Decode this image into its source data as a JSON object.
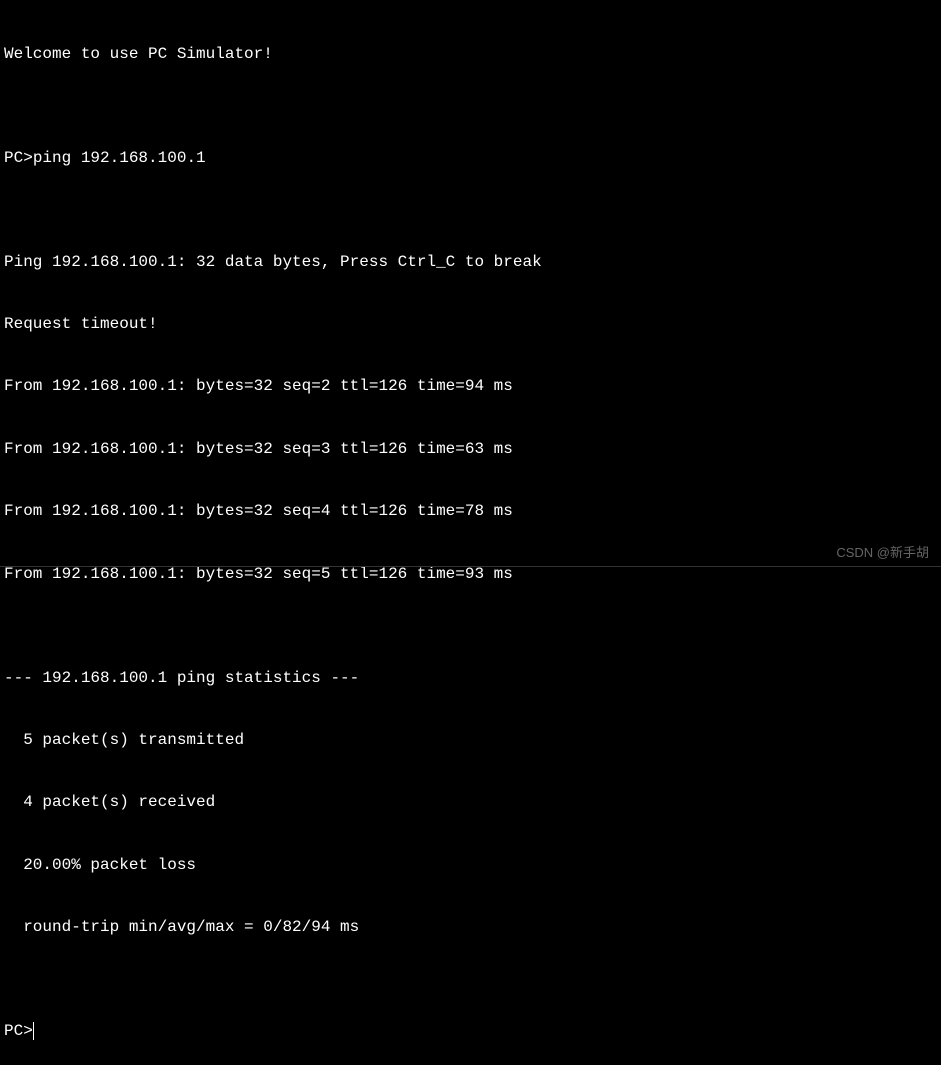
{
  "terminal": {
    "welcome": "Welcome to use PC Simulator!",
    "prompt1": "PC>",
    "command1": "ping 192.168.100.1",
    "blank": "",
    "ping_header": "Ping 192.168.100.1: 32 data bytes, Press Ctrl_C to break",
    "timeout": "Request timeout!",
    "reply1": "From 192.168.100.1: bytes=32 seq=2 ttl=126 time=94 ms",
    "reply2": "From 192.168.100.1: bytes=32 seq=3 ttl=126 time=63 ms",
    "reply3": "From 192.168.100.1: bytes=32 seq=4 ttl=126 time=78 ms",
    "reply4": "From 192.168.100.1: bytes=32 seq=5 ttl=126 time=93 ms",
    "stats_header": "--- 192.168.100.1 ping statistics ---",
    "stats_tx": "  5 packet(s) transmitted",
    "stats_rx": "  4 packet(s) received",
    "stats_loss": "  20.00% packet loss",
    "stats_rtt": "  round-trip min/avg/max = 0/82/94 ms",
    "prompt2": "PC>"
  },
  "watermark": "CSDN @新手胡"
}
